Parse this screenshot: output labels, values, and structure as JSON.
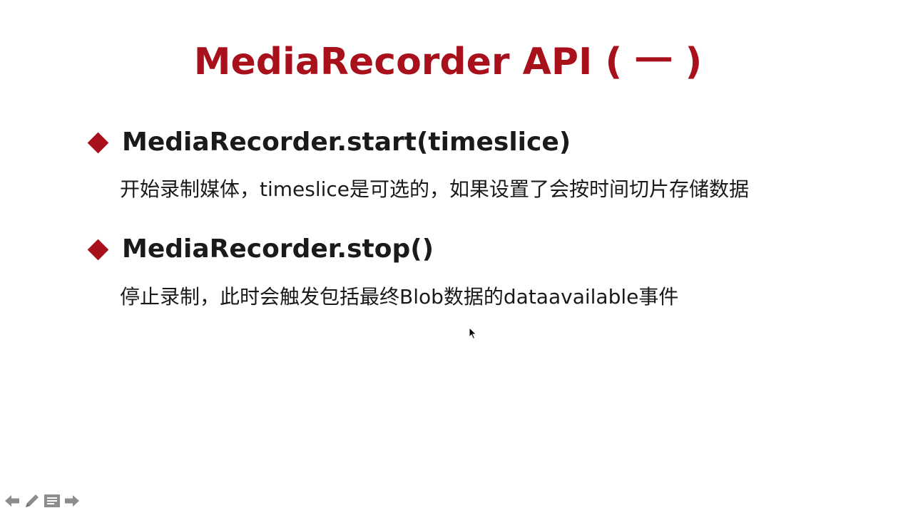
{
  "slide": {
    "title": "MediaRecorder API ( 一 )",
    "accent_color": "#a8111b",
    "bullets": [
      {
        "heading": "MediaRecorder.start(timeslice)",
        "description": "开始录制媒体，timeslice是可选的，如果设置了会按时间切片存储数据"
      },
      {
        "heading": "MediaRecorder.stop()",
        "description": "停止录制，此时会触发包括最终Blob数据的dataavailable事件"
      }
    ]
  },
  "nav_icons": [
    "arrow-left-icon",
    "pen-icon",
    "menu-icon",
    "arrow-right-icon"
  ]
}
